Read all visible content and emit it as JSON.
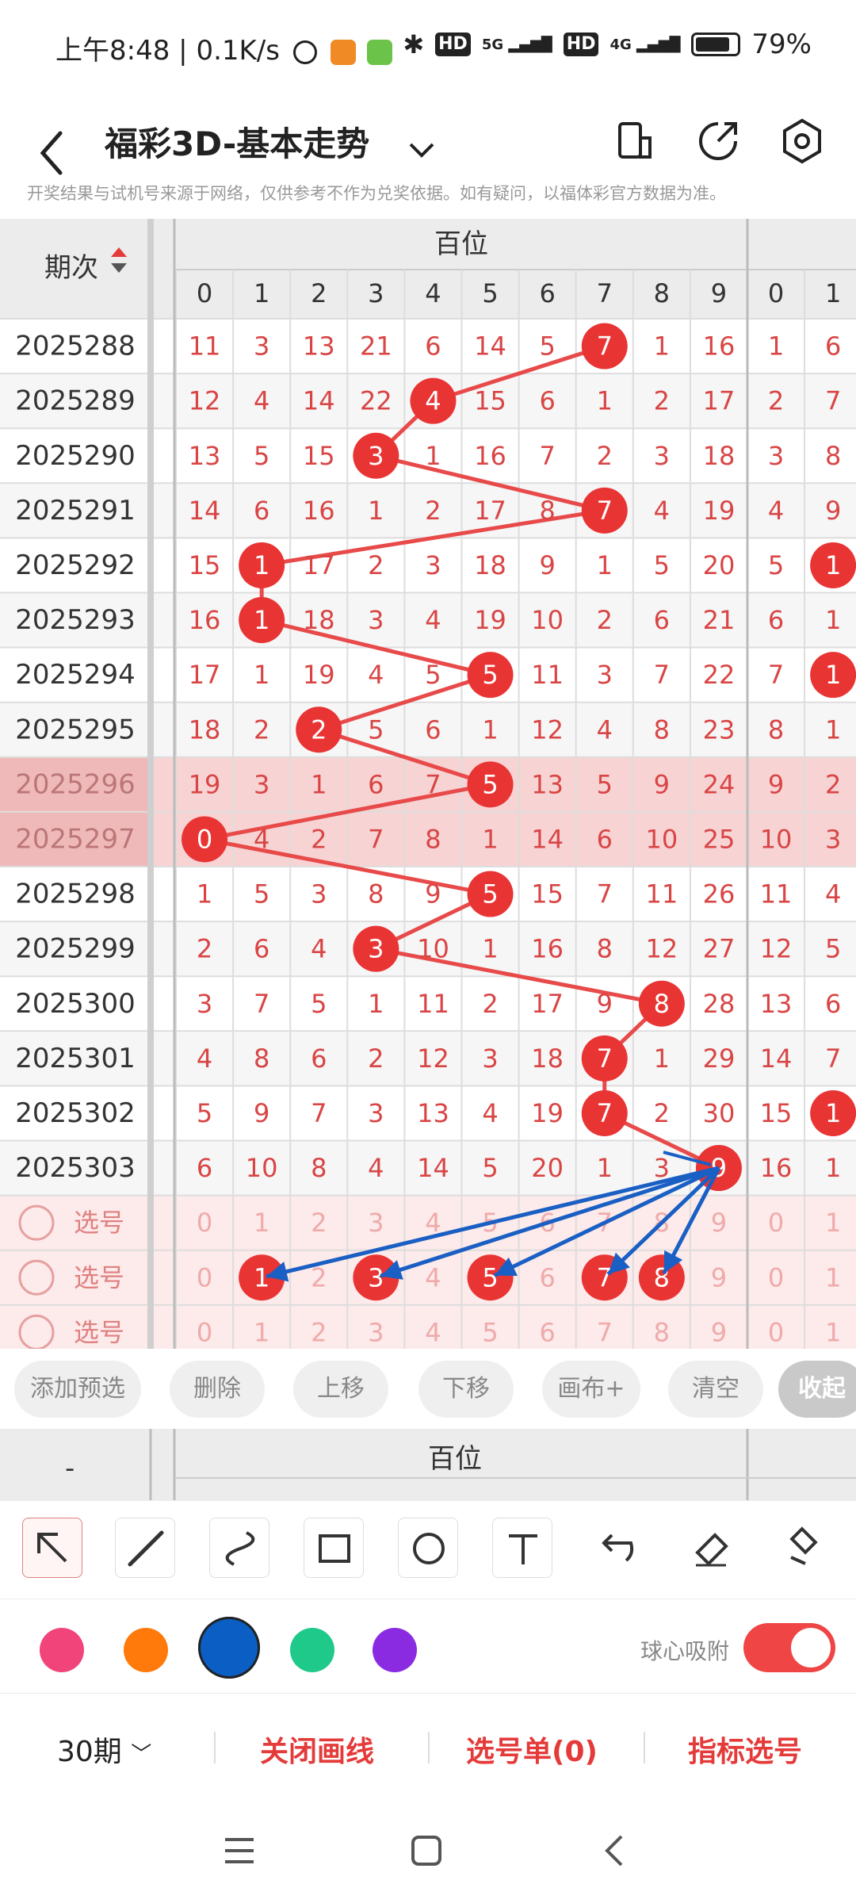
{
  "status_bar": {
    "time": "上午8:48",
    "speed": "0.1K/s",
    "battery": "79%",
    "network1": "5G",
    "network2": "4G",
    "hd": "HD"
  },
  "app_bar": {
    "title": "福彩3D-基本走势"
  },
  "notice": "开奖结果与试机号来源于网络，仅供参考不作为兑奖依据。如有疑问，以福体彩官方数据为准。",
  "table": {
    "period_header": "期次",
    "group_header": "百位",
    "digit_headers": [
      "0",
      "1",
      "2",
      "3",
      "4",
      "5",
      "6",
      "7",
      "8",
      "9",
      "0",
      "1"
    ],
    "rows": [
      {
        "period": "2025288",
        "hit": 7,
        "cells": [
          "11",
          "3",
          "13",
          "21",
          "6",
          "14",
          "5",
          "7",
          "1",
          "16",
          "1",
          "6"
        ],
        "extra_hit": false
      },
      {
        "period": "2025289",
        "hit": 4,
        "cells": [
          "12",
          "4",
          "14",
          "22",
          "4",
          "15",
          "6",
          "1",
          "2",
          "17",
          "2",
          "7"
        ],
        "extra_hit": false
      },
      {
        "period": "2025290",
        "hit": 3,
        "cells": [
          "13",
          "5",
          "15",
          "3",
          "1",
          "16",
          "7",
          "2",
          "3",
          "18",
          "3",
          "8"
        ],
        "extra_hit": false
      },
      {
        "period": "2025291",
        "hit": 7,
        "cells": [
          "14",
          "6",
          "16",
          "1",
          "2",
          "17",
          "8",
          "7",
          "4",
          "19",
          "4",
          "9"
        ],
        "extra_hit": false
      },
      {
        "period": "2025292",
        "hit": 1,
        "cells": [
          "15",
          "1",
          "17",
          "2",
          "3",
          "18",
          "9",
          "1",
          "5",
          "20",
          "5",
          "1"
        ],
        "extra_hit": true
      },
      {
        "period": "2025293",
        "hit": 1,
        "cells": [
          "16",
          "1",
          "18",
          "3",
          "4",
          "19",
          "10",
          "2",
          "6",
          "21",
          "6",
          "1"
        ],
        "extra_hit": false
      },
      {
        "period": "2025294",
        "hit": 5,
        "cells": [
          "17",
          "1",
          "19",
          "4",
          "5",
          "5",
          "11",
          "3",
          "7",
          "22",
          "7",
          "1"
        ],
        "extra_hit": true
      },
      {
        "period": "2025295",
        "hit": 2,
        "cells": [
          "18",
          "2",
          "2",
          "5",
          "6",
          "1",
          "12",
          "4",
          "8",
          "23",
          "8",
          "1"
        ],
        "extra_hit": false
      },
      {
        "period": "2025296",
        "hit": 5,
        "cells": [
          "19",
          "3",
          "1",
          "6",
          "7",
          "5",
          "13",
          "5",
          "9",
          "24",
          "9",
          "2"
        ],
        "extra_hit": false
      },
      {
        "period": "2025297",
        "hit": 0,
        "cells": [
          "0",
          "4",
          "2",
          "7",
          "8",
          "1",
          "14",
          "6",
          "10",
          "25",
          "10",
          "3"
        ],
        "extra_hit": false
      },
      {
        "period": "2025298",
        "hit": 5,
        "cells": [
          "1",
          "5",
          "3",
          "8",
          "9",
          "5",
          "15",
          "7",
          "11",
          "26",
          "11",
          "4"
        ],
        "extra_hit": false
      },
      {
        "period": "2025299",
        "hit": 3,
        "cells": [
          "2",
          "6",
          "4",
          "3",
          "10",
          "1",
          "16",
          "8",
          "12",
          "27",
          "12",
          "5"
        ],
        "extra_hit": false
      },
      {
        "period": "2025300",
        "hit": 8,
        "cells": [
          "3",
          "7",
          "5",
          "1",
          "11",
          "2",
          "17",
          "9",
          "8",
          "28",
          "13",
          "6"
        ],
        "extra_hit": false
      },
      {
        "period": "2025301",
        "hit": 7,
        "cells": [
          "4",
          "8",
          "6",
          "2",
          "12",
          "3",
          "18",
          "7",
          "1",
          "29",
          "14",
          "7"
        ],
        "extra_hit": false
      },
      {
        "period": "2025302",
        "hit": 7,
        "cells": [
          "5",
          "9",
          "7",
          "3",
          "13",
          "4",
          "19",
          "7",
          "2",
          "30",
          "15",
          "1"
        ],
        "extra_hit": true
      },
      {
        "period": "2025303",
        "hit": 9,
        "cells": [
          "6",
          "10",
          "8",
          "4",
          "14",
          "5",
          "20",
          "1",
          "3",
          "9",
          "16",
          "1"
        ],
        "extra_hit": false
      }
    ],
    "select_rows": [
      {
        "label": "选号",
        "cells": [
          "0",
          "1",
          "2",
          "3",
          "4",
          "5",
          "6",
          "7",
          "8",
          "9",
          "0",
          "1"
        ],
        "selected": []
      },
      {
        "label": "选号",
        "cells": [
          "0",
          "1",
          "2",
          "3",
          "4",
          "5",
          "6",
          "7",
          "8",
          "9",
          "0",
          "1"
        ],
        "selected": [
          1,
          3,
          5,
          7,
          8
        ]
      },
      {
        "label": "选号",
        "cells": [
          "0",
          "1",
          "2",
          "3",
          "4",
          "5",
          "6",
          "7",
          "8",
          "9",
          "0",
          "1"
        ],
        "selected": []
      }
    ],
    "highlight_periods": [
      "2025296",
      "2025297"
    ]
  },
  "actions": {
    "add_preselect": "添加预选",
    "delete": "删除",
    "move_up": "上移",
    "move_down": "下移",
    "canvas_plus": "画布+",
    "clear": "清空",
    "collapse": "收起"
  },
  "second_grid": {
    "group_header": "百位",
    "period_placeholder": "-"
  },
  "draw_tools": [
    "pointer-icon",
    "line-icon",
    "curve-icon",
    "rectangle-icon",
    "circle-icon",
    "text-icon",
    "undo-icon",
    "eraser-icon",
    "clear-brush-icon"
  ],
  "colors": {
    "swatches": [
      "#f0447a",
      "#ff7a0a",
      "#0b5fc4",
      "#1fc98a",
      "#8a2be2"
    ],
    "selected": "#0b5fc4",
    "accent": "#e53a3a",
    "arrow": "#1a5fc4"
  },
  "snap_toggle": {
    "label": "球心吸附",
    "on": true
  },
  "bottom_bar": {
    "periods": "30期",
    "close_lines": "关闭画线",
    "selection": "选号单(0)",
    "indicator": "指标选号"
  }
}
